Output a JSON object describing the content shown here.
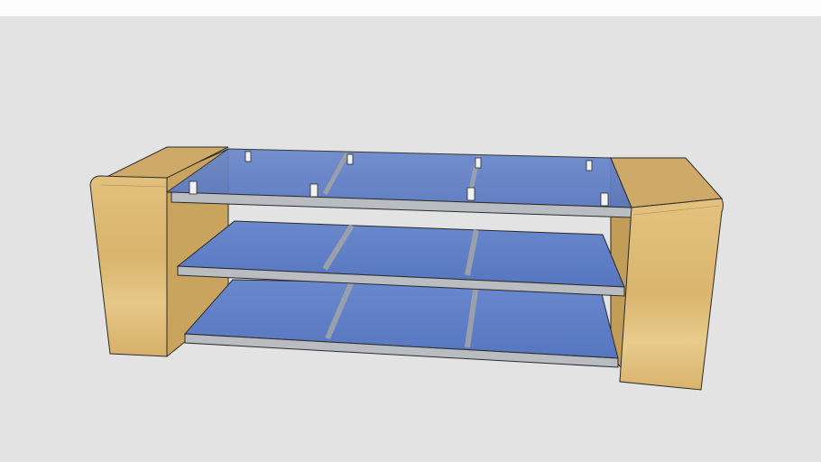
{
  "viewport": {
    "background_color": "#e3e3e3",
    "header_strip_color": "#fdfdfd"
  },
  "model": {
    "wood_color": "#dcb872",
    "wood_side_color": "#c9a45e",
    "wood_top_color": "#cfa967",
    "glass_color": "#5f7fc7",
    "steel_color": "#b9bcc1",
    "edge_color": "#2a2a2a",
    "shelf_count": 3
  }
}
